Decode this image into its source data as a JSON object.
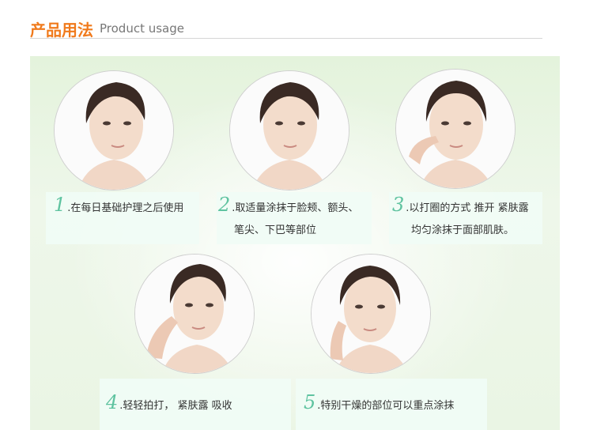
{
  "header": {
    "title_cn": "产品用法",
    "title_en": "Product usage"
  },
  "steps": [
    {
      "num": "1",
      "text": ".在每日基础护理之后使用"
    },
    {
      "num": "2",
      "text": ".取适量涂抹于脸颊、额头、",
      "text2": "笔尖、下巴等部位"
    },
    {
      "num": "3",
      "text": ".以打圈的方式 推开 紧肤露",
      "text2": "均匀涂抹于面部肌肤。"
    },
    {
      "num": "4",
      "text": ".轻轻拍打，      紧肤露 吸收"
    },
    {
      "num": "5",
      "text": ".特别干燥的部位可以重点涂抹"
    }
  ],
  "colors": {
    "accent": "#f07a1c",
    "step_number": "#5fc3a0",
    "background": "#e4f3dc"
  }
}
